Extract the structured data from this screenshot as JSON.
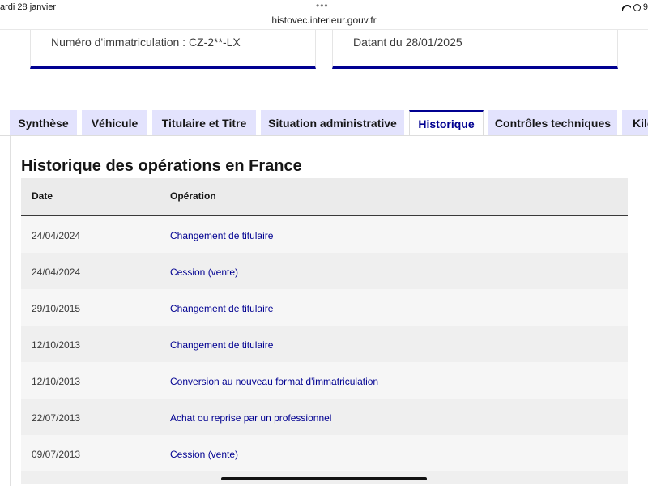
{
  "status_bar": {
    "time": "ardi 28 janvier",
    "dots": "•••",
    "url": "histovec.interieur.gouv.fr",
    "battery": "9"
  },
  "cards": {
    "immatriculation": "Numéro d'immatriculation : CZ-2**-LX",
    "datant": "Datant du 28/01/2025"
  },
  "tabs": [
    {
      "label": "Synthèse",
      "active": false
    },
    {
      "label": "Véhicule",
      "active": false
    },
    {
      "label": "Titulaire et Titre",
      "active": false
    },
    {
      "label": "Situation administrative",
      "active": false
    },
    {
      "label": "Historique",
      "active": true
    },
    {
      "label": "Contrôles techniques",
      "active": false
    },
    {
      "label": "Kilo",
      "active": false
    }
  ],
  "section": {
    "title": "Historique des opérations en France"
  },
  "table": {
    "headers": {
      "date": "Date",
      "operation": "Opération"
    },
    "rows": [
      {
        "date": "24/04/2024",
        "operation": "Changement de titulaire"
      },
      {
        "date": "24/04/2024",
        "operation": "Cession (vente)"
      },
      {
        "date": "29/10/2015",
        "operation": "Changement de titulaire"
      },
      {
        "date": "12/10/2013",
        "operation": "Changement de titulaire"
      },
      {
        "date": "12/10/2013",
        "operation": "Conversion au nouveau format d'immatriculation"
      },
      {
        "date": "22/07/2013",
        "operation": "Achat ou reprise par un professionnel"
      },
      {
        "date": "09/07/2013",
        "operation": "Cession (vente)"
      },
      {
        "date": "",
        "operation": ""
      }
    ]
  },
  "colors": {
    "accent": "#000091",
    "tab_bg": "#e3e3fd",
    "row_odd": "#f6f6f6",
    "row_even": "#efefef"
  }
}
